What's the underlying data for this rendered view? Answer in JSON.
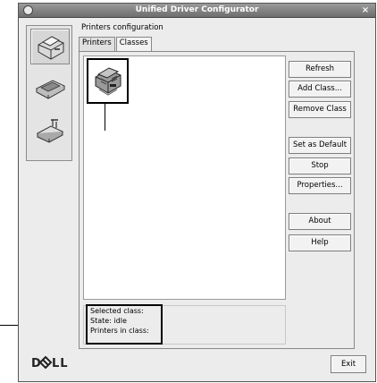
{
  "window": {
    "title": "Unified Driver Configurator",
    "close_glyph": "×"
  },
  "sidebar": {
    "items": [
      {
        "name": "printers-configuration",
        "icon": "printer-icon",
        "active": true
      },
      {
        "name": "scanners-configuration",
        "icon": "scanner-icon",
        "active": false
      },
      {
        "name": "ports-configuration",
        "icon": "port-icon",
        "active": false
      }
    ]
  },
  "main": {
    "section_title": "Printers configuration",
    "tabs": [
      {
        "label": "Printers",
        "active": false
      },
      {
        "label": "Classes",
        "active": true
      }
    ],
    "info": {
      "selected_class": "Selected class:",
      "state": "State: idle",
      "printers_in_class": "Printers in class:"
    }
  },
  "buttons": {
    "refresh": "Refresh",
    "add_class": "Add Class...",
    "remove_class": "Remove Class",
    "set_default": "Set as Default",
    "stop": "Stop",
    "properties": "Properties...",
    "about": "About",
    "help": "Help",
    "exit": "Exit"
  },
  "brand": {
    "logo": "DØLL"
  }
}
